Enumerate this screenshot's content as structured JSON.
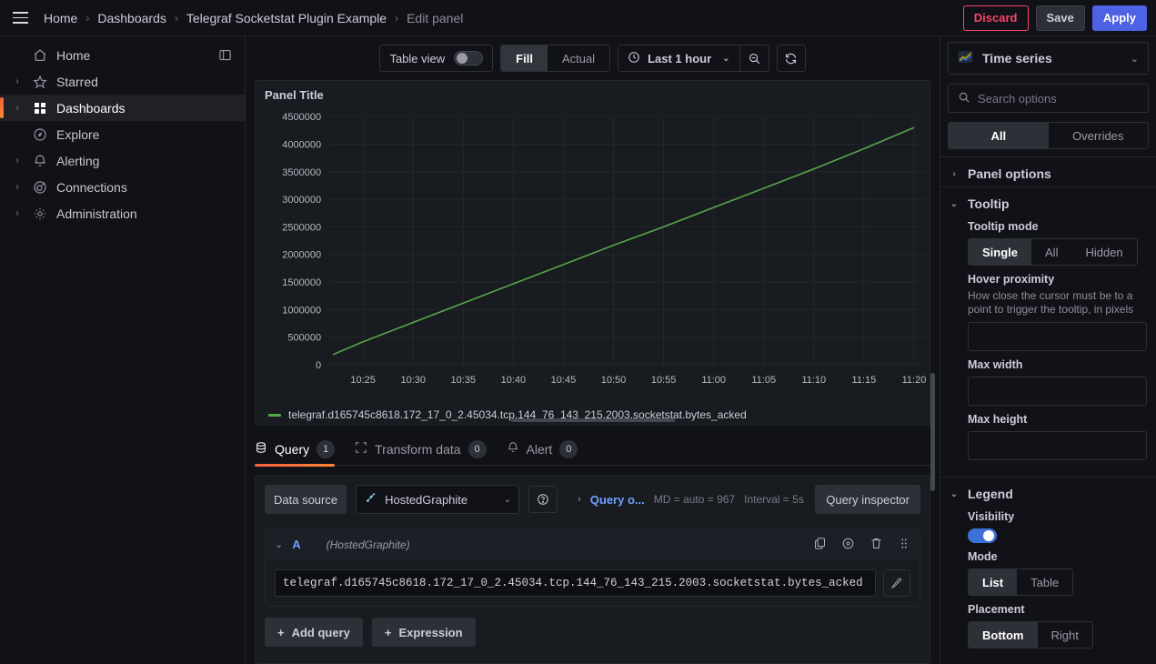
{
  "topbar": {
    "menu_icon": "hamburger-icon",
    "breadcrumbs": [
      {
        "label": "Home"
      },
      {
        "label": "Dashboards"
      },
      {
        "label": "Telegraf Socketstat Plugin Example"
      },
      {
        "label": "Edit panel"
      }
    ],
    "separator": "›",
    "discard_label": "Discard",
    "save_label": "Save",
    "apply_label": "Apply",
    "discard_color": "#f5456b",
    "apply_color": "#4d62e5"
  },
  "sidebar": {
    "items": [
      {
        "label": "Home",
        "icon": "home-icon",
        "expandable": false,
        "active": false
      },
      {
        "label": "Starred",
        "icon": "star-icon",
        "expandable": true,
        "active": false
      },
      {
        "label": "Dashboards",
        "icon": "dashboards-grid-icon",
        "expandable": true,
        "active": true
      },
      {
        "label": "Explore",
        "icon": "compass-icon",
        "expandable": false,
        "active": false
      },
      {
        "label": "Alerting",
        "icon": "bell-icon",
        "expandable": true,
        "active": false
      },
      {
        "label": "Connections",
        "icon": "connections-icon",
        "expandable": true,
        "active": false
      },
      {
        "label": "Administration",
        "icon": "gear-icon",
        "expandable": true,
        "active": false
      }
    ],
    "dock_icon": "dock-menu-icon",
    "active_accent": "#f55f3e"
  },
  "toolbar": {
    "table_view_label": "Table view",
    "table_view_on": false,
    "fill_label": "Fill",
    "actual_label": "Actual",
    "fill_selected": true,
    "time_range": "Last 1 hour",
    "time_icon": "clock-icon",
    "time_caret": "chevron-down-icon",
    "zoom_out_icon": "zoom-out-icon",
    "refresh_icon": "refresh-icon"
  },
  "panel": {
    "title": "Panel Title",
    "legend_series": "telegraf.d165745c8618.172_17_0_2.45034.tcp.144_76_143_215.2003.socketstat.bytes_acked",
    "series_color": "#56a64b"
  },
  "chart_data": {
    "type": "line",
    "title": "Panel Title",
    "xlabel": "",
    "ylabel": "",
    "grid": true,
    "legend_position": "bottom",
    "ylim": [
      0,
      4500000
    ],
    "yticks": [
      0,
      500000,
      1000000,
      1500000,
      2000000,
      2500000,
      3000000,
      3500000,
      4000000,
      4500000
    ],
    "xticks": [
      "10:25",
      "10:30",
      "10:35",
      "10:40",
      "10:45",
      "10:50",
      "10:55",
      "11:00",
      "11:05",
      "11:10",
      "11:15",
      "11:20"
    ],
    "series": [
      {
        "name": "telegraf.d165745c8618.172_17_0_2.45034.tcp.144_76_143_215.2003.socketstat.bytes_acked",
        "color": "#56a64b",
        "x": [
          "10:22",
          "10:25",
          "10:30",
          "10:35",
          "10:40",
          "10:45",
          "10:50",
          "10:55",
          "11:00",
          "11:05",
          "11:10",
          "11:15",
          "11:20"
        ],
        "values": [
          180000,
          420000,
          760000,
          1110000,
          1460000,
          1810000,
          2160000,
          2500000,
          2850000,
          3200000,
          3550000,
          3920000,
          4300000
        ]
      }
    ]
  },
  "query_tabs": [
    {
      "label": "Query",
      "count": "1",
      "icon": "database-icon",
      "active": true
    },
    {
      "label": "Transform data",
      "count": "0",
      "icon": "transform-icon",
      "active": false
    },
    {
      "label": "Alert",
      "count": "0",
      "icon": "bell-icon",
      "active": false
    }
  ],
  "query_editor": {
    "datasource_label": "Data source",
    "datasource_name": "HostedGraphite",
    "datasource_icon": "graphite-logo-icon",
    "help_icon": "help-circle-icon",
    "query_options_label": "Query o...",
    "md_info": "MD = auto = 967",
    "interval_info": "Interval = 5s",
    "query_inspector_label": "Query inspector",
    "row": {
      "letter": "A",
      "datasource": "(HostedGraphite)",
      "expression": "telegraf.d165745c8618.172_17_0_2.45034.tcp.144_76_143_215.2003.socketstat.bytes_acked",
      "actions": [
        "copy-icon",
        "hide-eye-icon",
        "trash-icon",
        "drag-handle-icon"
      ],
      "edit_icon": "pencil-icon"
    },
    "add_query_label": "Add query",
    "expression_label": "Expression"
  },
  "options_pane": {
    "viz_name": "Time series",
    "viz_icon": "time-series-icon",
    "search_placeholder": "Search options",
    "search_icon": "search-icon",
    "tabs": [
      {
        "label": "All",
        "selected": true
      },
      {
        "label": "Overrides",
        "selected": false
      }
    ],
    "sections": [
      {
        "title": "Panel options",
        "expanded": false
      },
      {
        "title": "Tooltip",
        "expanded": true
      },
      {
        "title": "Legend",
        "expanded": true
      }
    ],
    "tooltip": {
      "mode_label": "Tooltip mode",
      "mode_options": [
        "Single",
        "All",
        "Hidden"
      ],
      "mode_selected": "Single",
      "hover_label": "Hover proximity",
      "hover_desc": "How close the cursor must be to a point to trigger the tooltip, in pixels",
      "hover_value": "",
      "max_width_label": "Max width",
      "max_width_value": "",
      "max_height_label": "Max height",
      "max_height_value": ""
    },
    "legend": {
      "visibility_label": "Visibility",
      "visibility_on": true,
      "mode_label": "Mode",
      "mode_options": [
        "List",
        "Table"
      ],
      "mode_selected": "List",
      "placement_label": "Placement",
      "placement_options": [
        "Bottom",
        "Right"
      ],
      "placement_selected": "Bottom"
    }
  }
}
